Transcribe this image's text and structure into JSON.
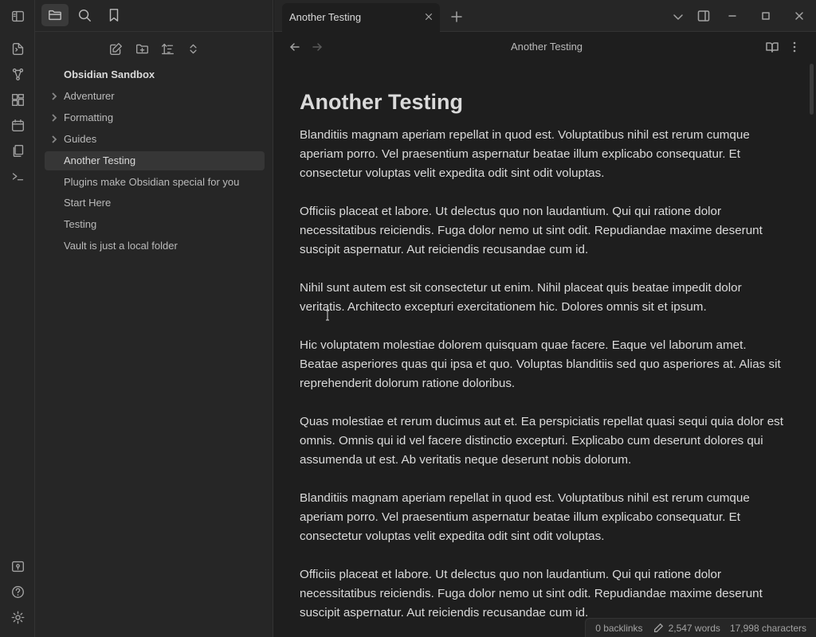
{
  "ribbon": {
    "items": [
      {
        "icon": "sidebar-toggle-icon"
      },
      {
        "icon": "open-quick-switcher-icon"
      },
      {
        "icon": "graph-view-icon"
      },
      {
        "icon": "canvas-icon"
      },
      {
        "icon": "daily-note-icon"
      },
      {
        "icon": "templates-icon"
      },
      {
        "icon": "command-palette-icon"
      }
    ],
    "bottom": [
      {
        "icon": "vault-switcher-icon"
      },
      {
        "icon": "help-icon"
      },
      {
        "icon": "settings-icon"
      }
    ]
  },
  "sidebar": {
    "tabs": [
      {
        "icon": "files-icon",
        "active": true
      },
      {
        "icon": "search-icon",
        "active": false
      },
      {
        "icon": "bookmark-icon",
        "active": false
      }
    ],
    "vault_name": "Obsidian Sandbox",
    "items": [
      {
        "label": "Adventurer",
        "folder": true
      },
      {
        "label": "Formatting",
        "folder": true
      },
      {
        "label": "Guides",
        "folder": true
      },
      {
        "label": "Another Testing",
        "folder": false,
        "active": true
      },
      {
        "label": "Plugins make Obsidian special for you",
        "folder": false
      },
      {
        "label": "Start Here",
        "folder": false
      },
      {
        "label": "Testing",
        "folder": false
      },
      {
        "label": "Vault is just a local folder",
        "folder": false
      }
    ]
  },
  "tab": {
    "title": "Another Testing"
  },
  "view_header": {
    "title": "Another Testing"
  },
  "document": {
    "title": "Another Testing",
    "paragraphs": [
      "Blanditiis magnam aperiam repellat in quod est. Voluptatibus nihil est rerum cumque aperiam porro. Vel praesentium aspernatur beatae illum explicabo consequatur. Et consectetur voluptas velit expedita odit sint odit voluptas.",
      "Officiis placeat et labore. Ut delectus quo non laudantium. Qui qui ratione dolor necessitatibus reiciendis. Fuga dolor nemo ut sint odit. Repudiandae maxime deserunt suscipit aspernatur. Aut reiciendis recusandae cum id.",
      "Nihil sunt autem est sit consectetur ut enim. Nihil placeat quis beatae impedit dolor veritatis. Architecto excepturi exercitationem hic. Dolores omnis sit et ipsum.",
      "Hic voluptatem molestiae dolorem quisquam quae facere. Eaque vel laborum amet. Beatae asperiores quas qui ipsa et quo. Voluptas blanditiis sed quo asperiores at. Alias sit reprehenderit dolorum ratione doloribus.",
      "Quas molestiae et rerum ducimus aut et. Ea perspiciatis repellat quasi sequi quia dolor est omnis. Omnis qui id vel facere distinctio excepturi. Explicabo cum deserunt dolores qui assumenda ut est. Ab veritatis neque deserunt nobis dolorum.",
      "Blanditiis magnam aperiam repellat in quod est. Voluptatibus nihil est rerum cumque aperiam porro. Vel praesentium aspernatur beatae illum explicabo consequatur. Et consectetur voluptas velit expedita odit sint odit voluptas.",
      "Officiis placeat et labore. Ut delectus quo non laudantium. Qui qui ratione dolor necessitatibus reiciendis. Fuga dolor nemo ut sint odit. Repudiandae maxime deserunt suscipit aspernatur. Aut reiciendis recusandae cum id."
    ]
  },
  "status": {
    "backlinks": "0 backlinks",
    "words": "2,547 words",
    "characters": "17,998 characters"
  }
}
